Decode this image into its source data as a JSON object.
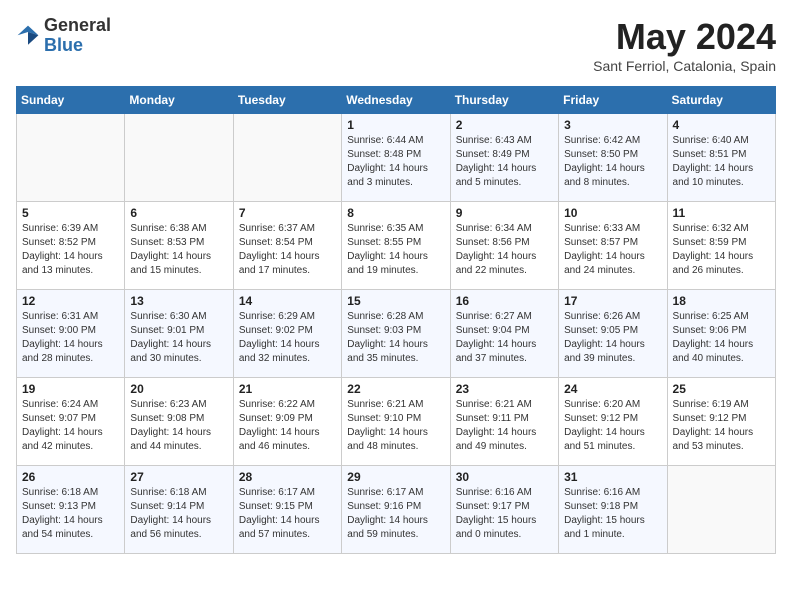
{
  "header": {
    "logo_general": "General",
    "logo_blue": "Blue",
    "month_title": "May 2024",
    "location": "Sant Ferriol, Catalonia, Spain"
  },
  "days_of_week": [
    "Sunday",
    "Monday",
    "Tuesday",
    "Wednesday",
    "Thursday",
    "Friday",
    "Saturday"
  ],
  "weeks": [
    [
      {
        "day": "",
        "detail": ""
      },
      {
        "day": "",
        "detail": ""
      },
      {
        "day": "",
        "detail": ""
      },
      {
        "day": "1",
        "detail": "Sunrise: 6:44 AM\nSunset: 8:48 PM\nDaylight: 14 hours\nand 3 minutes."
      },
      {
        "day": "2",
        "detail": "Sunrise: 6:43 AM\nSunset: 8:49 PM\nDaylight: 14 hours\nand 5 minutes."
      },
      {
        "day": "3",
        "detail": "Sunrise: 6:42 AM\nSunset: 8:50 PM\nDaylight: 14 hours\nand 8 minutes."
      },
      {
        "day": "4",
        "detail": "Sunrise: 6:40 AM\nSunset: 8:51 PM\nDaylight: 14 hours\nand 10 minutes."
      }
    ],
    [
      {
        "day": "5",
        "detail": "Sunrise: 6:39 AM\nSunset: 8:52 PM\nDaylight: 14 hours\nand 13 minutes."
      },
      {
        "day": "6",
        "detail": "Sunrise: 6:38 AM\nSunset: 8:53 PM\nDaylight: 14 hours\nand 15 minutes."
      },
      {
        "day": "7",
        "detail": "Sunrise: 6:37 AM\nSunset: 8:54 PM\nDaylight: 14 hours\nand 17 minutes."
      },
      {
        "day": "8",
        "detail": "Sunrise: 6:35 AM\nSunset: 8:55 PM\nDaylight: 14 hours\nand 19 minutes."
      },
      {
        "day": "9",
        "detail": "Sunrise: 6:34 AM\nSunset: 8:56 PM\nDaylight: 14 hours\nand 22 minutes."
      },
      {
        "day": "10",
        "detail": "Sunrise: 6:33 AM\nSunset: 8:57 PM\nDaylight: 14 hours\nand 24 minutes."
      },
      {
        "day": "11",
        "detail": "Sunrise: 6:32 AM\nSunset: 8:59 PM\nDaylight: 14 hours\nand 26 minutes."
      }
    ],
    [
      {
        "day": "12",
        "detail": "Sunrise: 6:31 AM\nSunset: 9:00 PM\nDaylight: 14 hours\nand 28 minutes."
      },
      {
        "day": "13",
        "detail": "Sunrise: 6:30 AM\nSunset: 9:01 PM\nDaylight: 14 hours\nand 30 minutes."
      },
      {
        "day": "14",
        "detail": "Sunrise: 6:29 AM\nSunset: 9:02 PM\nDaylight: 14 hours\nand 32 minutes."
      },
      {
        "day": "15",
        "detail": "Sunrise: 6:28 AM\nSunset: 9:03 PM\nDaylight: 14 hours\nand 35 minutes."
      },
      {
        "day": "16",
        "detail": "Sunrise: 6:27 AM\nSunset: 9:04 PM\nDaylight: 14 hours\nand 37 minutes."
      },
      {
        "day": "17",
        "detail": "Sunrise: 6:26 AM\nSunset: 9:05 PM\nDaylight: 14 hours\nand 39 minutes."
      },
      {
        "day": "18",
        "detail": "Sunrise: 6:25 AM\nSunset: 9:06 PM\nDaylight: 14 hours\nand 40 minutes."
      }
    ],
    [
      {
        "day": "19",
        "detail": "Sunrise: 6:24 AM\nSunset: 9:07 PM\nDaylight: 14 hours\nand 42 minutes."
      },
      {
        "day": "20",
        "detail": "Sunrise: 6:23 AM\nSunset: 9:08 PM\nDaylight: 14 hours\nand 44 minutes."
      },
      {
        "day": "21",
        "detail": "Sunrise: 6:22 AM\nSunset: 9:09 PM\nDaylight: 14 hours\nand 46 minutes."
      },
      {
        "day": "22",
        "detail": "Sunrise: 6:21 AM\nSunset: 9:10 PM\nDaylight: 14 hours\nand 48 minutes."
      },
      {
        "day": "23",
        "detail": "Sunrise: 6:21 AM\nSunset: 9:11 PM\nDaylight: 14 hours\nand 49 minutes."
      },
      {
        "day": "24",
        "detail": "Sunrise: 6:20 AM\nSunset: 9:12 PM\nDaylight: 14 hours\nand 51 minutes."
      },
      {
        "day": "25",
        "detail": "Sunrise: 6:19 AM\nSunset: 9:12 PM\nDaylight: 14 hours\nand 53 minutes."
      }
    ],
    [
      {
        "day": "26",
        "detail": "Sunrise: 6:18 AM\nSunset: 9:13 PM\nDaylight: 14 hours\nand 54 minutes."
      },
      {
        "day": "27",
        "detail": "Sunrise: 6:18 AM\nSunset: 9:14 PM\nDaylight: 14 hours\nand 56 minutes."
      },
      {
        "day": "28",
        "detail": "Sunrise: 6:17 AM\nSunset: 9:15 PM\nDaylight: 14 hours\nand 57 minutes."
      },
      {
        "day": "29",
        "detail": "Sunrise: 6:17 AM\nSunset: 9:16 PM\nDaylight: 14 hours\nand 59 minutes."
      },
      {
        "day": "30",
        "detail": "Sunrise: 6:16 AM\nSunset: 9:17 PM\nDaylight: 15 hours\nand 0 minutes."
      },
      {
        "day": "31",
        "detail": "Sunrise: 6:16 AM\nSunset: 9:18 PM\nDaylight: 15 hours\nand 1 minute."
      },
      {
        "day": "",
        "detail": ""
      }
    ]
  ]
}
